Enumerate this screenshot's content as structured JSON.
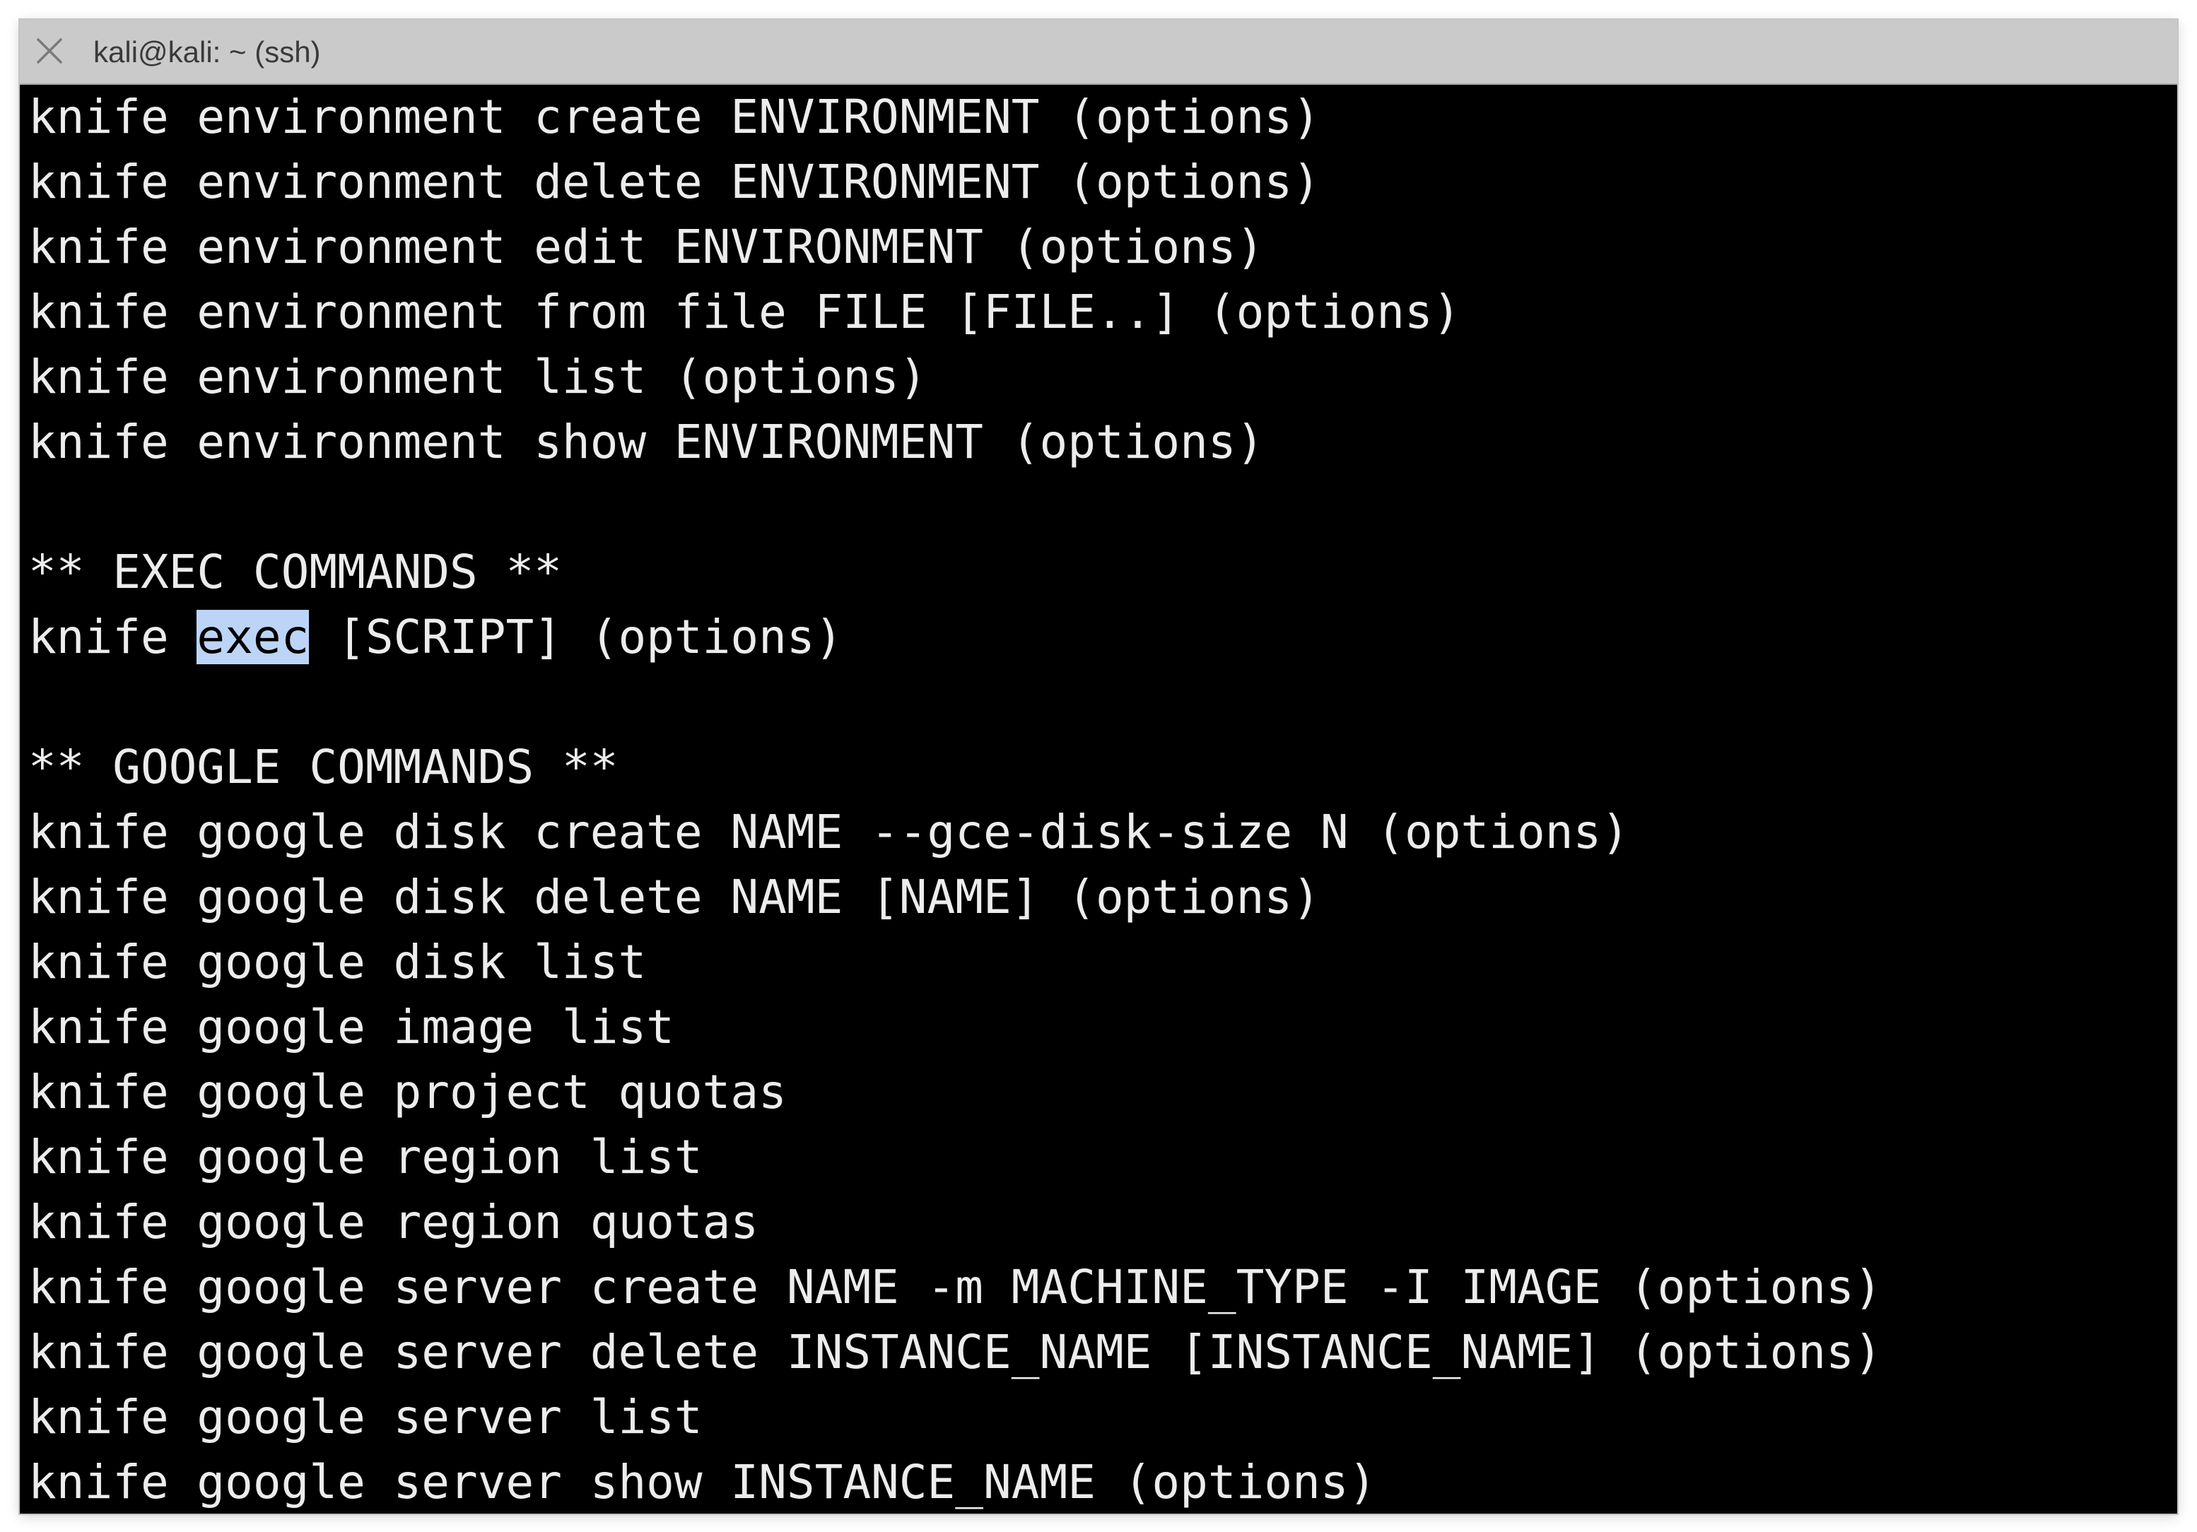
{
  "window": {
    "title": "kali@kali: ~ (ssh)"
  },
  "terminal": {
    "lines": [
      {
        "text": "knife environment create ENVIRONMENT (options)"
      },
      {
        "text": "knife environment delete ENVIRONMENT (options)"
      },
      {
        "text": "knife environment edit ENVIRONMENT (options)"
      },
      {
        "text": "knife environment from file FILE [FILE..] (options)"
      },
      {
        "text": "knife environment list (options)"
      },
      {
        "text": "knife environment show ENVIRONMENT (options)"
      },
      {
        "text": ""
      },
      {
        "text": "** EXEC COMMANDS **"
      },
      {
        "pre": "knife ",
        "selected": "exec",
        "post": " [SCRIPT] (options)"
      },
      {
        "text": ""
      },
      {
        "text": "** GOOGLE COMMANDS **"
      },
      {
        "text": "knife google disk create NAME --gce-disk-size N (options)"
      },
      {
        "text": "knife google disk delete NAME [NAME] (options)"
      },
      {
        "text": "knife google disk list"
      },
      {
        "text": "knife google image list"
      },
      {
        "text": "knife google project quotas"
      },
      {
        "text": "knife google region list"
      },
      {
        "text": "knife google region quotas"
      },
      {
        "text": "knife google server create NAME -m MACHINE_TYPE -I IMAGE (options)"
      },
      {
        "text": "knife google server delete INSTANCE_NAME [INSTANCE_NAME] (options)"
      },
      {
        "text": "knife google server list"
      },
      {
        "text": "knife google server show INSTANCE_NAME (options)"
      }
    ]
  },
  "colors": {
    "terminal_background": "#000000",
    "terminal_text": "#ececec",
    "selection_highlight": "#bcd5f7",
    "titlebar": "#cacaca"
  },
  "icons": {
    "close": "close-icon"
  }
}
